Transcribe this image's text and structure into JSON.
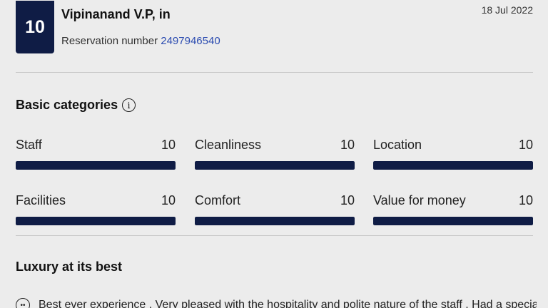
{
  "review": {
    "score": "10",
    "reviewer_name": "Vipinanand V.P, in",
    "date": "18 Jul 2022",
    "reservation_label": "Reservation number",
    "reservation_number": "2497946540"
  },
  "basic_categories": {
    "title": "Basic categories",
    "info_icon": "info-icon",
    "items": [
      {
        "label": "Staff",
        "score": "10",
        "fill": 1.0
      },
      {
        "label": "Cleanliness",
        "score": "10",
        "fill": 1.0
      },
      {
        "label": "Location",
        "score": "10",
        "fill": 1.0
      },
      {
        "label": "Facilities",
        "score": "10",
        "fill": 1.0
      },
      {
        "label": "Comfort",
        "score": "10",
        "fill": 1.0
      },
      {
        "label": "Value for money",
        "score": "10",
        "fill": 1.0
      }
    ]
  },
  "review_text": {
    "title": "Luxury at its best",
    "body": "Best ever experience . Very pleased with the hospitality and polite nature of the staff . Had a special",
    "icon": "smiley-icon"
  },
  "colors": {
    "accent": "#0f1c45",
    "link": "#2b4bb0",
    "background": "#ececec"
  }
}
